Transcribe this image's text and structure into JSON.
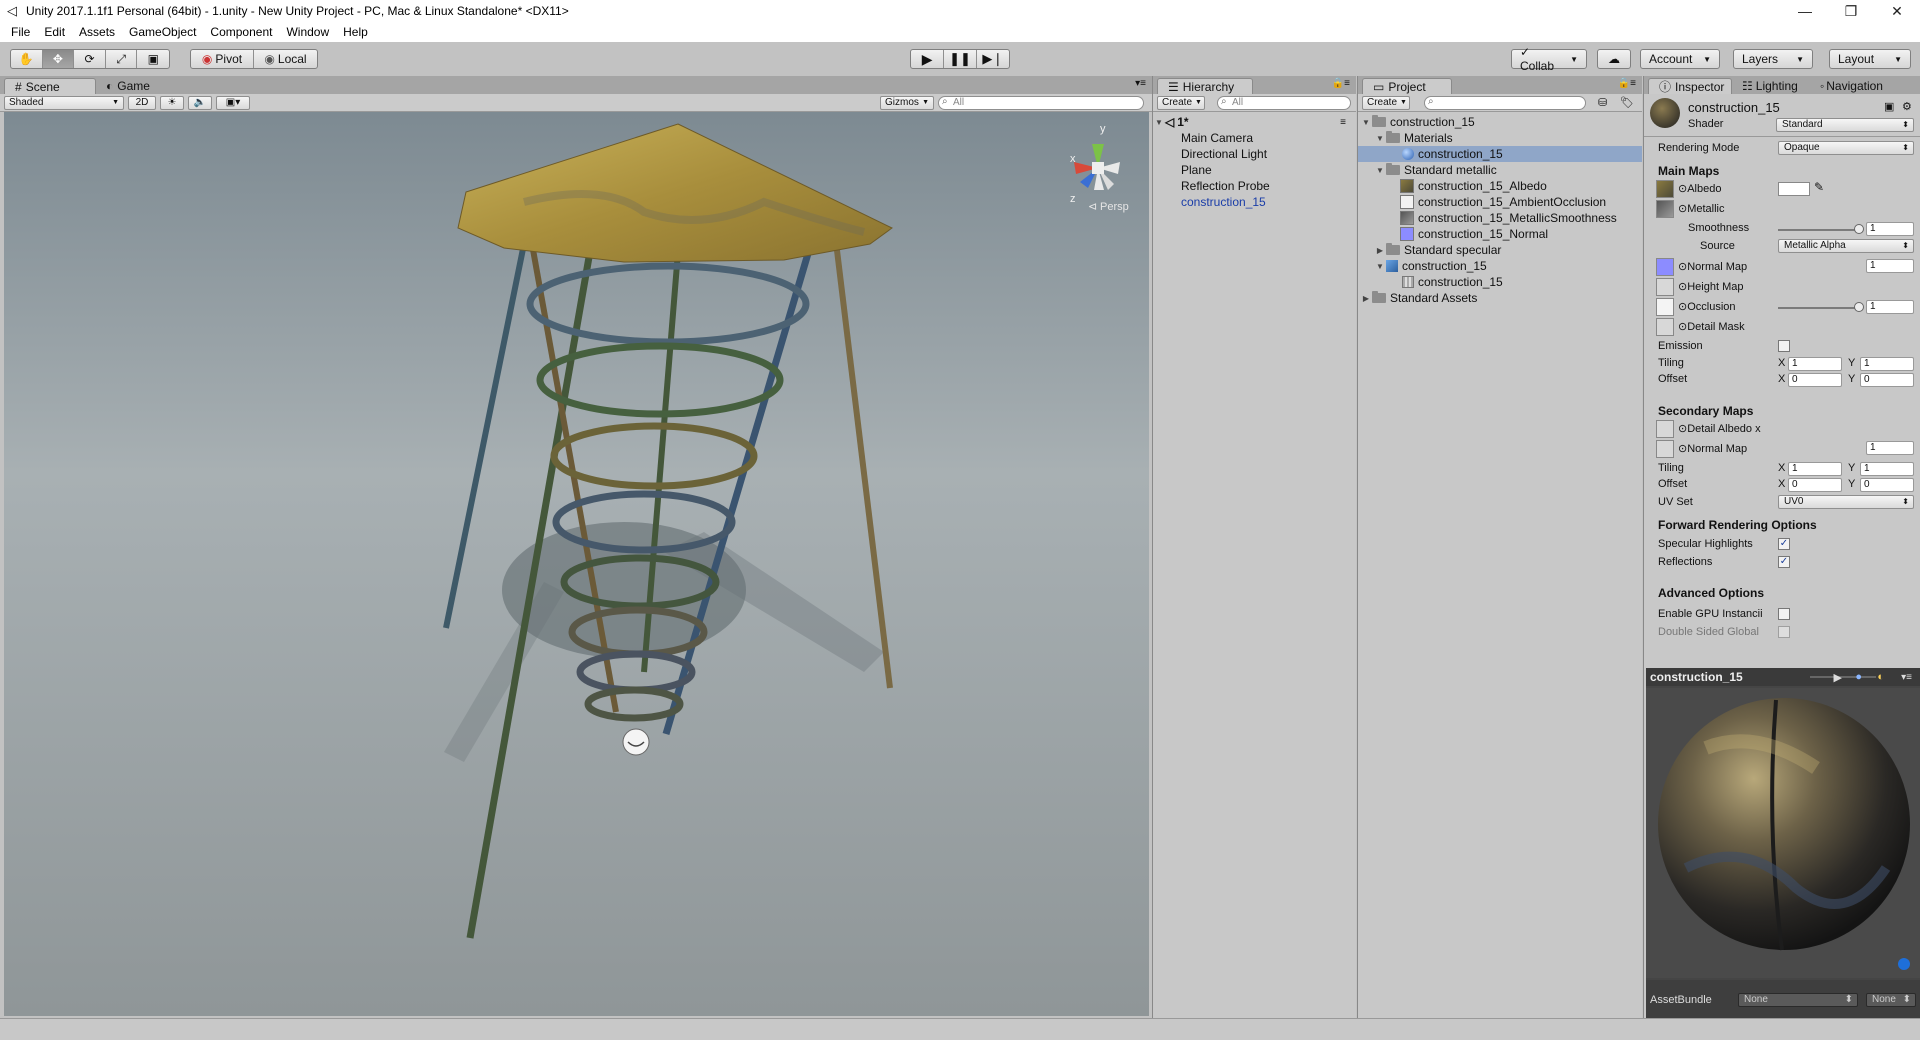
{
  "window": {
    "title": "Unity 2017.1.1f1 Personal (64bit) - 1.unity - New Unity Project - PC, Mac & Linux Standalone* <DX11>"
  },
  "menu": [
    "File",
    "Edit",
    "Assets",
    "GameObject",
    "Component",
    "Window",
    "Help"
  ],
  "toolbar": {
    "pivot": "Pivot",
    "local": "Local",
    "collab": "Collab",
    "account": "Account",
    "layers": "Layers",
    "layout": "Layout"
  },
  "scene": {
    "tabs": {
      "scene": "Scene",
      "game": "Game"
    },
    "shading": "Shaded",
    "mode2d": "2D",
    "gizmos": "Gizmos",
    "search_placeholder": "All",
    "persp": "Persp",
    "gizmo_y": "y",
    "gizmo_x": "x",
    "gizmo_z": "z"
  },
  "hierarchy": {
    "tab": "Hierarchy",
    "create": "Create",
    "search_placeholder": "All",
    "scene_name": "1*",
    "items": [
      "Main Camera",
      "Directional Light",
      "Plane",
      "Reflection Probe",
      "construction_15"
    ]
  },
  "project": {
    "tab": "Project",
    "create": "Create",
    "items": [
      "construction_15",
      "Materials",
      "construction_15",
      "Standard metallic",
      "construction_15_Albedo",
      "construction_15_AmbientOcclusion",
      "construction_15_MetallicSmoothness",
      "construction_15_Normal",
      "Standard specular",
      "construction_15",
      "construction_15",
      "Standard Assets"
    ]
  },
  "inspector": {
    "tabs": {
      "inspector": "Inspector",
      "lighting": "Lighting",
      "navigation": "Navigation"
    },
    "material_name": "construction_15",
    "shader_label": "Shader",
    "shader_value": "Standard",
    "rendering_mode_label": "Rendering Mode",
    "rendering_mode_value": "Opaque",
    "main_maps": "Main Maps",
    "albedo": "Albedo",
    "metallic": "Metallic",
    "smoothness": "Smoothness",
    "smoothness_value": "1",
    "source": "Source",
    "source_value": "Metallic Alpha",
    "normal_map": "Normal Map",
    "normal_value": "1",
    "height_map": "Height Map",
    "occlusion": "Occlusion",
    "occlusion_value": "1",
    "detail_mask": "Detail Mask",
    "emission": "Emission",
    "tiling": "Tiling",
    "offset": "Offset",
    "x": "X",
    "y": "Y",
    "tiling_x": "1",
    "tiling_y": "1",
    "offset_x": "0",
    "offset_y": "0",
    "secondary_maps": "Secondary Maps",
    "detail_albedo": "Detail Albedo x",
    "normal_map2": "Normal Map",
    "normal_value2": "1",
    "tiling2_x": "1",
    "tiling2_y": "1",
    "offset2_x": "0",
    "offset2_y": "0",
    "uv_set": "UV Set",
    "uv_set_value": "UV0",
    "forward_options": "Forward Rendering Options",
    "specular_highlights": "Specular Highlights",
    "reflections": "Reflections",
    "advanced_options": "Advanced Options",
    "gpu_instancing": "Enable GPU Instancii",
    "double_sided": "Double Sided Global"
  },
  "preview": {
    "title": "construction_15",
    "assetbundle_label": "AssetBundle",
    "assetbundle_value": "None",
    "variant_value": "None"
  },
  "colors": {
    "accent_blue": "#1a3da8",
    "selection": "#8fa6c8",
    "canopy": "#b9a24a",
    "metal_green": "#3d5a3a",
    "metal_blue": "#3a5470"
  }
}
